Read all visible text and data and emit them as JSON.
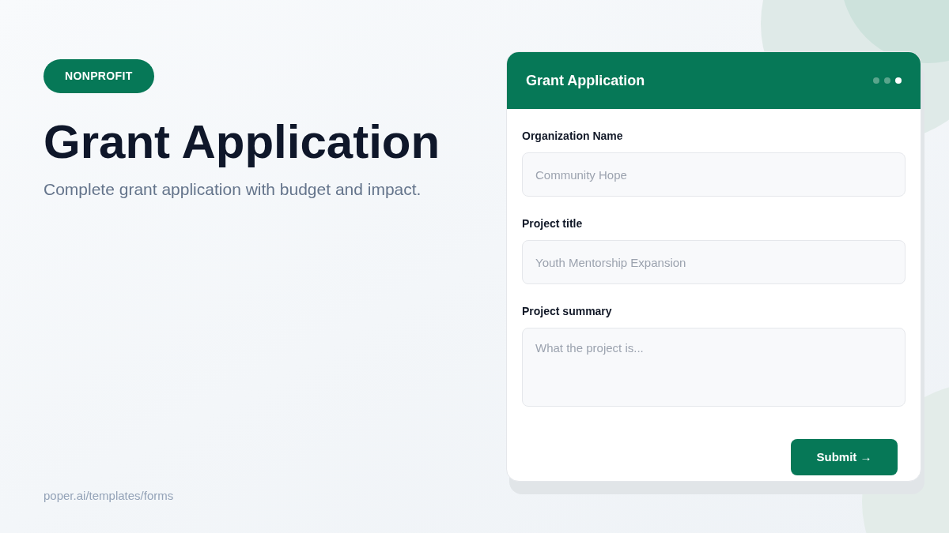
{
  "badge": "NONPROFIT",
  "title": "Grant Application",
  "subtitle": "Complete grant application with budget and impact.",
  "footer_link": "poper.ai/templates/forms",
  "form": {
    "title": "Grant Application",
    "steps": [
      {
        "selected": false
      },
      {
        "selected": false
      },
      {
        "selected": true
      }
    ],
    "fields": [
      {
        "kind": "input",
        "label": "Organization Name",
        "placeholder": "Community Hope"
      },
      {
        "kind": "input",
        "label": "Project title",
        "placeholder": "Youth Mentorship Expansion"
      },
      {
        "kind": "textarea",
        "label": "Project summary",
        "placeholder": "What the project is..."
      }
    ],
    "submit": "Submit →"
  }
}
